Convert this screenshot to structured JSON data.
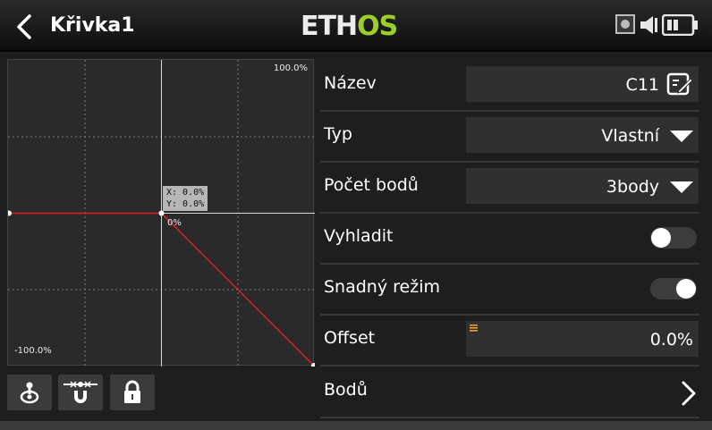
{
  "header": {
    "title": "Křivka1",
    "logo": {
      "part1": "ETH",
      "part2": "OS"
    }
  },
  "graph": {
    "top_label": "100.0%",
    "bottom_label": "-100.0%",
    "tooltip_x": "X: 0.0%",
    "tooltip_y": "Y: 0.0%",
    "center_label": "0%",
    "curve_points": [
      [
        -100,
        0
      ],
      [
        0,
        0
      ],
      [
        100,
        -100
      ]
    ],
    "curve_color": "#e02020"
  },
  "tools": [
    "joystick-icon",
    "magnet-icon",
    "lock-icon"
  ],
  "rows": {
    "name": {
      "label": "Název",
      "value": "C11"
    },
    "type": {
      "label": "Typ",
      "value": "Vlastní"
    },
    "points": {
      "label": "Počet bodů",
      "value": "3body"
    },
    "smooth": {
      "label": "Vyhladit",
      "on": false
    },
    "easy": {
      "label": "Snadný režim",
      "on": true
    },
    "offset": {
      "label": "Offset",
      "value": "0.0%"
    },
    "bodu": {
      "label": "Bodů"
    }
  },
  "colors": {
    "accent": "#9ccf2a",
    "orange": "#f0a020"
  }
}
